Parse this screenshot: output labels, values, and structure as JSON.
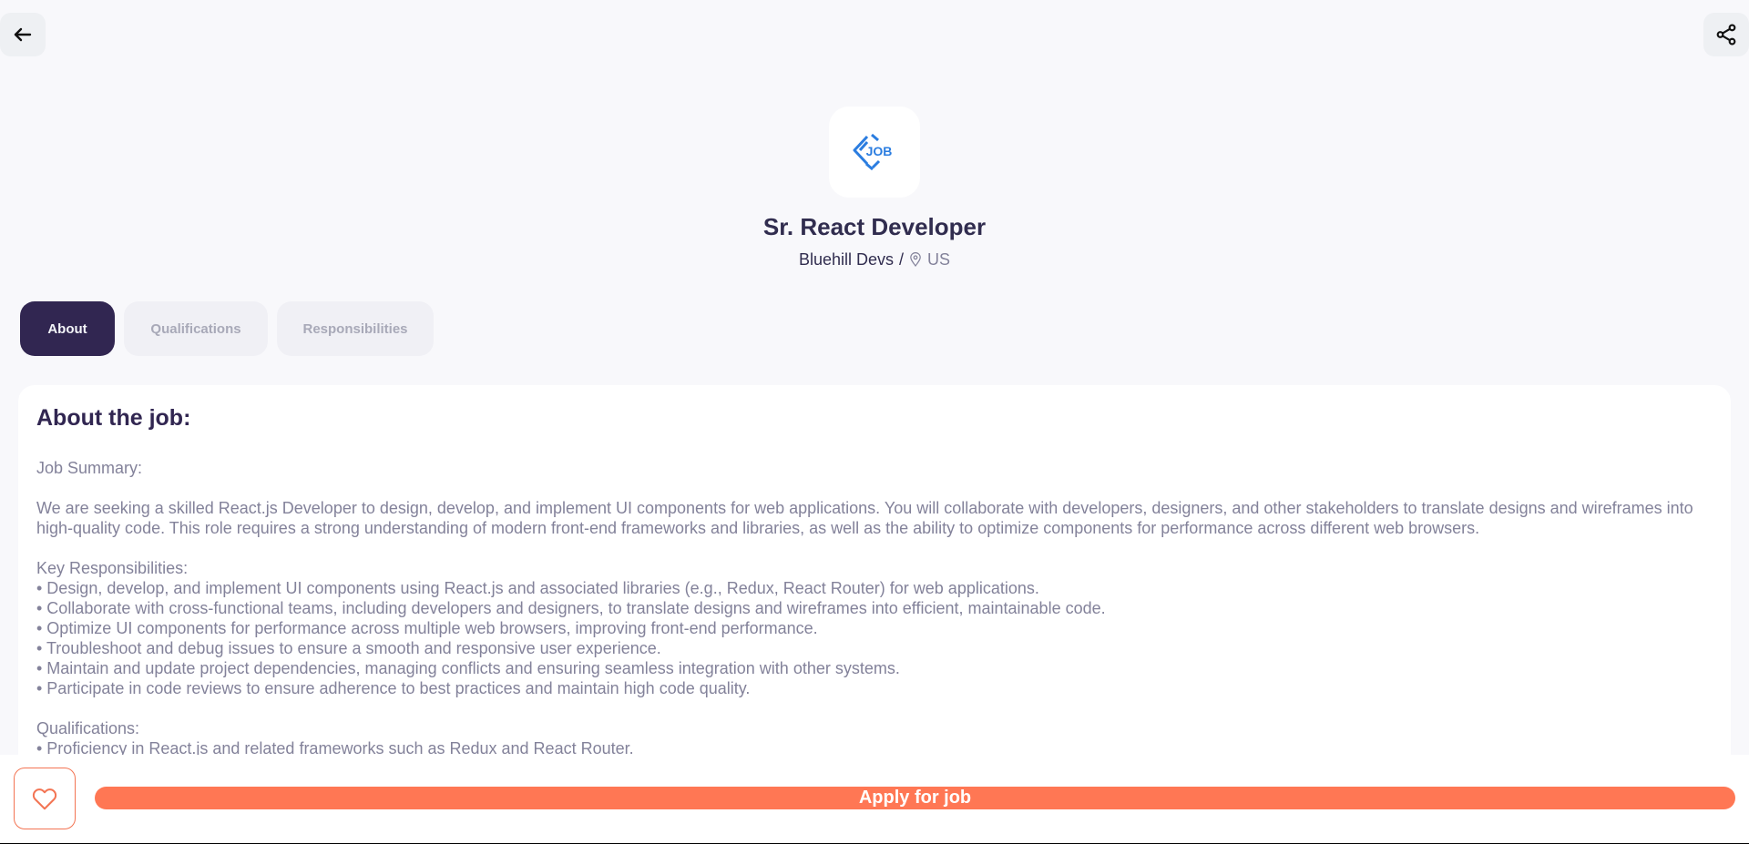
{
  "header": {
    "back_icon": "arrow-left-icon",
    "share_icon": "share-icon"
  },
  "company": {
    "logo_text": "JOB",
    "job_title": "Sr. React Developer",
    "name": "Bluehill Devs",
    "separator": "/",
    "location": "US",
    "location_icon": "map-pin-icon"
  },
  "tabs": [
    {
      "label": "About",
      "active": true
    },
    {
      "label": "Qualifications",
      "active": false
    },
    {
      "label": "Responsibilities",
      "active": false
    }
  ],
  "about": {
    "heading": "About the job:",
    "body": "Job Summary:\n\nWe are seeking a skilled React.js Developer to design, develop, and implement UI components for web applications. You will collaborate with developers, designers, and other stakeholders to translate designs and wireframes into high-quality code. This role requires a strong understanding of modern front-end frameworks and libraries, as well as the ability to optimize components for performance across different web browsers.\n\nKey Responsibilities:\n• Design, develop, and implement UI components using React.js and associated libraries (e.g., Redux, React Router) for web applications.\n• Collaborate with cross-functional teams, including developers and designers, to translate designs and wireframes into efficient, maintainable code.\n• Optimize UI components for performance across multiple web browsers, improving front-end performance.\n• Troubleshoot and debug issues to ensure a smooth and responsive user experience.\n• Maintain and update project dependencies, managing conflicts and ensuring seamless integration with other systems.\n• Participate in code reviews to ensure adherence to best practices and maintain high code quality.\n\nQualifications:\n• Proficiency in React.js and related frameworks such as Redux and React Router."
  },
  "footer": {
    "like_icon": "heart-icon",
    "apply_label": "Apply for job"
  },
  "colors": {
    "primary": "#312651",
    "accent": "#ff7754",
    "muted_text": "#83829a",
    "logo_blue": "#2b7de0"
  }
}
